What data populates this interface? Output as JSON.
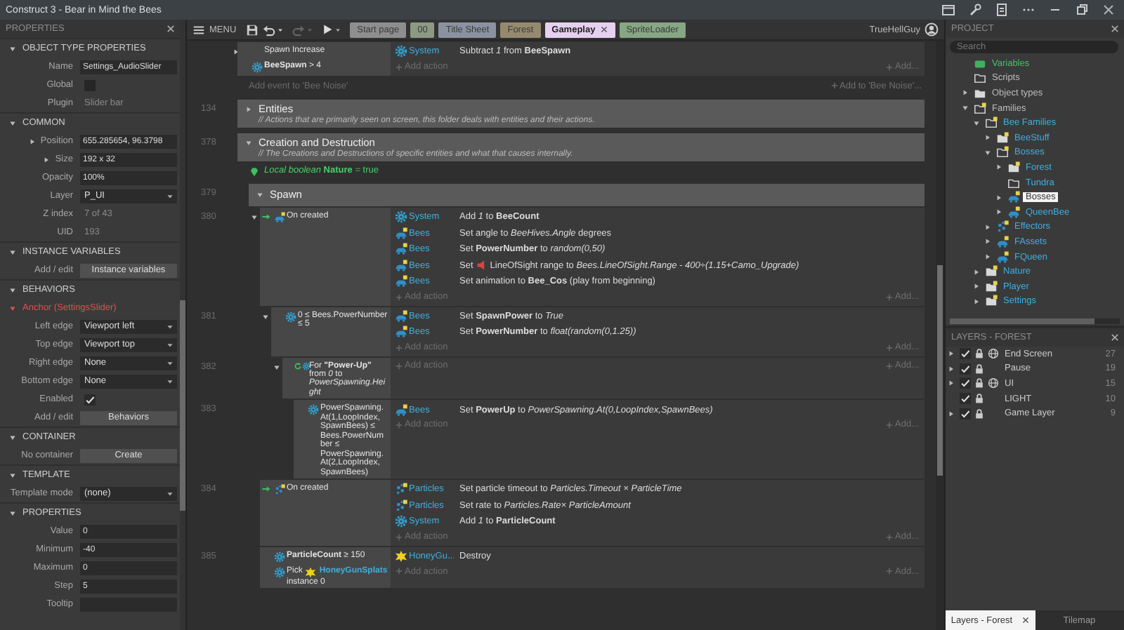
{
  "title_bar": {
    "title": "Construct 3 - Bear in Mind the Bees"
  },
  "properties": {
    "title": "PROPERTIES",
    "sections": [
      {
        "title": "OBJECT TYPE PROPERTIES",
        "rows": [
          {
            "kind": "field",
            "label": "Name",
            "value": "Settings_AudioSlider"
          },
          {
            "kind": "checkbox",
            "label": "Global",
            "checked": false
          },
          {
            "kind": "text",
            "label": "Plugin",
            "value": "Slider bar"
          }
        ]
      },
      {
        "title": "COMMON",
        "rows": [
          {
            "kind": "field",
            "label": "Position",
            "value": "655.285654, 96.3798",
            "expanded": false
          },
          {
            "kind": "field",
            "label": "Size",
            "value": "192 x 32",
            "expanded": false
          },
          {
            "kind": "field",
            "label": "Opacity",
            "value": "100%"
          },
          {
            "kind": "dropdown",
            "label": "Layer",
            "value": "P_UI"
          },
          {
            "kind": "text",
            "label": "Z index",
            "value": "7 of 43"
          },
          {
            "kind": "text",
            "label": "UID",
            "value": "193"
          }
        ]
      },
      {
        "title": "INSTANCE VARIABLES",
        "rows": [
          {
            "kind": "button",
            "label": "Add / edit",
            "value": "Instance variables"
          }
        ]
      },
      {
        "title": "BEHAVIORS",
        "rows": [
          {
            "kind": "behavior",
            "value": "Anchor (SettingsSlider)"
          },
          {
            "kind": "dropdown",
            "label": "Left edge",
            "value": "Viewport left"
          },
          {
            "kind": "dropdown",
            "label": "Top edge",
            "value": "Viewport top"
          },
          {
            "kind": "dropdown",
            "label": "Right edge",
            "value": "None"
          },
          {
            "kind": "dropdown",
            "label": "Bottom edge",
            "value": "None"
          },
          {
            "kind": "checkbox",
            "label": "Enabled",
            "checked": true
          },
          {
            "kind": "button",
            "label": "Add / edit",
            "value": "Behaviors"
          }
        ]
      },
      {
        "title": "CONTAINER",
        "rows": [
          {
            "kind": "button",
            "label": "No container",
            "value": "Create"
          }
        ]
      },
      {
        "title": "TEMPLATE",
        "rows": [
          {
            "kind": "dropdown",
            "label": "Template mode",
            "value": "(none)"
          }
        ]
      },
      {
        "title": "PROPERTIES",
        "rows": [
          {
            "kind": "field",
            "label": "Value",
            "value": "0"
          },
          {
            "kind": "field",
            "label": "Minimum",
            "value": "-40"
          },
          {
            "kind": "field",
            "label": "Maximum",
            "value": "0"
          },
          {
            "kind": "field",
            "label": "Step",
            "value": "5"
          },
          {
            "kind": "field",
            "label": "Tooltip"
          }
        ]
      }
    ]
  },
  "toolbar": {
    "menu": "MENU",
    "history": [
      {
        "kind": "undo",
        "disabled": false
      },
      {
        "kind": "redo",
        "disabled": true
      }
    ],
    "tabs": [
      {
        "label": "Start page",
        "color": "#8e8e8e",
        "selected": false
      },
      {
        "label": "00",
        "color": "#8c9a84",
        "selected": false
      },
      {
        "label": "Title Sheet",
        "color": "#8a92a2",
        "selected": false
      },
      {
        "label": "Forest",
        "color": "#958a6e",
        "selected": false
      },
      {
        "label": "Gameplay",
        "color": "#e6d0f0",
        "selected": true
      },
      {
        "label": "SpriteLoader",
        "color": "#86a684",
        "selected": false
      }
    ],
    "user": "TrueHellGuy"
  },
  "event_sheet": {
    "rows": [
      {
        "kind": "event",
        "expanded": false,
        "conditions": [
          {
            "trigger": false,
            "text": "Spawn Increase"
          },
          {
            "trigger": false,
            "kind": "system",
            "text": "**BeeSpawn** > 4"
          }
        ],
        "actions": [
          {
            "object": "System",
            "kind": "system",
            "text": "Subtract *1* from **BeeSpawn**"
          }
        ],
        "add_action": "Add action",
        "add_more": "Add..."
      },
      {
        "kind": "add_event",
        "text": "Add event to 'Bee Noise'",
        "side_text": "Add to 'Bee Noise'..."
      },
      {
        "kind": "group",
        "line": "134",
        "title": "Entities",
        "comment": "//  Actions that are primarily seen on screen, this folder deals with entities and their actions.",
        "expanded": false
      },
      {
        "kind": "group",
        "line": "378",
        "title": "Creation and Destruction",
        "comment": "//  The Creations and Destructions of specific entities and what that causes internally.",
        "expanded": true,
        "children": [
          {
            "kind": "variable",
            "text": "*Local boolean* **Nature** = true"
          },
          {
            "kind": "group",
            "line": "379",
            "title": "Spawn",
            "expanded": true,
            "children": [
              {
                "kind": "event",
                "line": "380",
                "expanded": true,
                "conditions": [
                  {
                    "trigger": true,
                    "kind": "sprite",
                    "text": "On created"
                  }
                ],
                "actions": [
                  {
                    "object": "System",
                    "kind": "system",
                    "text": "Add *1* to **BeeCount**"
                  },
                  {
                    "object": "Bees",
                    "kind": "sprite",
                    "text": "Set angle to *BeeHives.Angle* degrees"
                  },
                  {
                    "object": "Bees",
                    "kind": "sprite",
                    "text": "Set **PowerNumber** to *random(0,50)*"
                  },
                  {
                    "object": "Bees",
                    "kind": "sprite",
                    "text": "Set",
                    "text_after": "LineOfSight range to *Bees.LineOfSight.Range - 400÷(1.15+Camo_Upgrade)*"
                  },
                  {
                    "object": "Bees",
                    "kind": "sprite",
                    "text": "Set animation to **Bee_Cos** (play from beginning)"
                  }
                ],
                "add_action": "Add action",
                "add_more": "Add...",
                "children": [
                  {
                    "kind": "event",
                    "line": "381",
                    "expanded": true,
                    "conditions": [
                      {
                        "trigger": false,
                        "kind": "system",
                        "text": "0 ≤ Bees.PowerNumber ≤ 5"
                      }
                    ],
                    "actions": [
                      {
                        "object": "Bees",
                        "kind": "sprite",
                        "text": "Set **SpawnPower** to *True*"
                      },
                      {
                        "object": "Bees",
                        "kind": "sprite",
                        "text": "Set **PowerNumber** to *float(random(0,1.25))*"
                      }
                    ],
                    "add_action": "Add action",
                    "add_more": "Add...",
                    "children": [
                      {
                        "kind": "event",
                        "line": "382",
                        "expanded": true,
                        "conditions": [
                          {
                            "trigger": false,
                            "kind": "loop",
                            "text": "For **\"Power-Up\"** from *0* to *PowerSpawning.Height*"
                          }
                        ],
                        "add_action": "Add action",
                        "add_more": "Add...",
                        "children": [
                          {
                            "kind": "event",
                            "line": "383",
                            "conditions": [
                              {
                                "trigger": false,
                                "kind": "system",
                                "text": "PowerSpawning.At(1,LoopIndex, SpawnBees) ≤ Bees.PowerNumber ≤ PowerSpawning.At(2,LoopIndex, SpawnBees)"
                              }
                            ],
                            "actions": [
                              {
                                "object": "Bees",
                                "kind": "sprite",
                                "text": "Set **PowerUp** to *PowerSpawning.At(0,LoopIndex,SpawnBees)*"
                              }
                            ],
                            "add_action": "Add action",
                            "add_more": "Add..."
                          }
                        ]
                      }
                    ]
                  }
                ]
              },
              {
                "kind": "event",
                "line": "384",
                "conditions": [
                  {
                    "trigger": true,
                    "kind": "particles",
                    "text": "On created"
                  }
                ],
                "actions": [
                  {
                    "object": "Particles",
                    "kind": "particles",
                    "text": "Set particle timeout to *Particles.Timeout × ParticleTime*"
                  },
                  {
                    "object": "Particles",
                    "kind": "particles",
                    "text": "Set rate to *Particles.Rate× ParticleAmount*"
                  },
                  {
                    "object": "System",
                    "kind": "system",
                    "text": "Add *1* to **ParticleCount**"
                  }
                ],
                "add_action": "Add action",
                "add_more": "Add..."
              },
              {
                "kind": "event",
                "line": "385",
                "conditions": [
                  {
                    "trigger": false,
                    "kind": "system",
                    "text": "**ParticleCount** ≥ 150"
                  },
                  {
                    "trigger": false,
                    "kind": "pick",
                    "text": "Pick",
                    "object": "HoneyGunSplats",
                    "text_after": "instance 0"
                  }
                ],
                "actions": [
                  {
                    "object": "HoneyGu...",
                    "kind": "splat",
                    "text": "Destroy"
                  }
                ],
                "add_action": "Add action",
                "add_more": "Add..."
              }
            ]
          }
        ]
      }
    ]
  },
  "project": {
    "title": "PROJECT",
    "search": {
      "placeholder": "Search"
    },
    "tree": [
      {
        "label": "Variables",
        "kind": "variables",
        "family": false,
        "badge": false,
        "selected": false
      },
      {
        "label": "Scripts",
        "kind": "folder",
        "family": false,
        "badge": false,
        "selected": false
      },
      {
        "label": "Object types",
        "kind": "folder_filled",
        "family": false,
        "badge": false,
        "expanded": false,
        "selected": false
      },
      {
        "label": "Families",
        "kind": "folder",
        "family": false,
        "badge": true,
        "expanded": true,
        "selected": false,
        "children": [
          {
            "label": "Bee Families",
            "kind": "folder",
            "family": true,
            "badge": true,
            "expanded": true,
            "selected": false,
            "children": [
              {
                "label": "BeeStuff",
                "kind": "folder_filled",
                "family": true,
                "badge": true,
                "expanded": false,
                "selected": false
              },
              {
                "label": "Bosses",
                "kind": "folder",
                "family": true,
                "badge": true,
                "expanded": true,
                "selected": false,
                "children": [
                  {
                    "label": "Forest",
                    "kind": "folder_filled",
                    "family": true,
                    "badge": true,
                    "expanded": false,
                    "selected": false
                  },
                  {
                    "label": "Tundra",
                    "kind": "folder",
                    "family": true,
                    "badge": false,
                    "selected": false
                  },
                  {
                    "label": "Bosses",
                    "kind": "sprite",
                    "family": true,
                    "badge": true,
                    "expanded": false,
                    "selected": true
                  },
                  {
                    "label": "QueenBee",
                    "kind": "sprite",
                    "family": true,
                    "badge": true,
                    "expanded": false,
                    "selected": false
                  }
                ]
              },
              {
                "label": "Effectors",
                "kind": "particles",
                "family": true,
                "badge": true,
                "expanded": false,
                "selected": false
              },
              {
                "label": "FAssets",
                "kind": "sprite",
                "family": true,
                "badge": true,
                "expanded": false,
                "selected": false
              },
              {
                "label": "FQueen",
                "kind": "sprite",
                "family": true,
                "badge": true,
                "expanded": false,
                "selected": false
              }
            ]
          },
          {
            "label": "Nature",
            "kind": "folder_filled",
            "family": true,
            "badge": true,
            "expanded": false,
            "selected": false
          },
          {
            "label": "Player",
            "kind": "folder_filled",
            "family": true,
            "badge": true,
            "expanded": false,
            "selected": false
          },
          {
            "label": "Settings",
            "kind": "folder_filled",
            "family": true,
            "badge": true,
            "expanded": false,
            "selected": false
          }
        ]
      }
    ]
  },
  "layers": {
    "title": "LAYERS - FOREST",
    "items": [
      {
        "name": "End Screen",
        "count": "27",
        "expanded": false,
        "visible": true,
        "global": true
      },
      {
        "name": "Pause",
        "count": "19",
        "expanded": false,
        "visible": true,
        "global": false
      },
      {
        "name": "UI",
        "count": "15",
        "expanded": false,
        "visible": true,
        "global": true
      },
      {
        "name": "LIGHT",
        "count": "10",
        "visible": true,
        "global": false
      },
      {
        "name": "Game Layer",
        "count": "9",
        "expanded": false,
        "visible": true,
        "global": false
      }
    ]
  },
  "bottom_tabs": [
    {
      "label": "Layers - Forest",
      "selected": true
    },
    {
      "label": "Tilemap",
      "selected": false
    }
  ]
}
